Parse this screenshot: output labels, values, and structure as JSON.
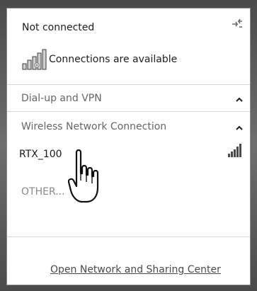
{
  "status": {
    "title": "Not connected",
    "availability": "Connections are available"
  },
  "sections": {
    "dialup": {
      "title": "Dial-up and VPN",
      "expanded": true
    },
    "wireless": {
      "title": "Wireless Network Connection",
      "expanded": true
    }
  },
  "networks": [
    {
      "name": "RTX_100",
      "signal_icon": "signal-bars-icon"
    }
  ],
  "other": {
    "label": "OTHER..."
  },
  "footer": {
    "link": "Open Network and Sharing Center"
  },
  "icons": {
    "refresh": "refresh-arrows-icon",
    "availability": "network-bars-icon",
    "collapse": "chevron-up-icon",
    "cursor": "hand-pointer-icon"
  },
  "colors": {
    "panel_bg": "#ffffff",
    "frame_bg": "#5a5a5a",
    "title_text": "#1e1e1e",
    "section_text": "#666666",
    "muted_text": "#8a8a8a"
  }
}
